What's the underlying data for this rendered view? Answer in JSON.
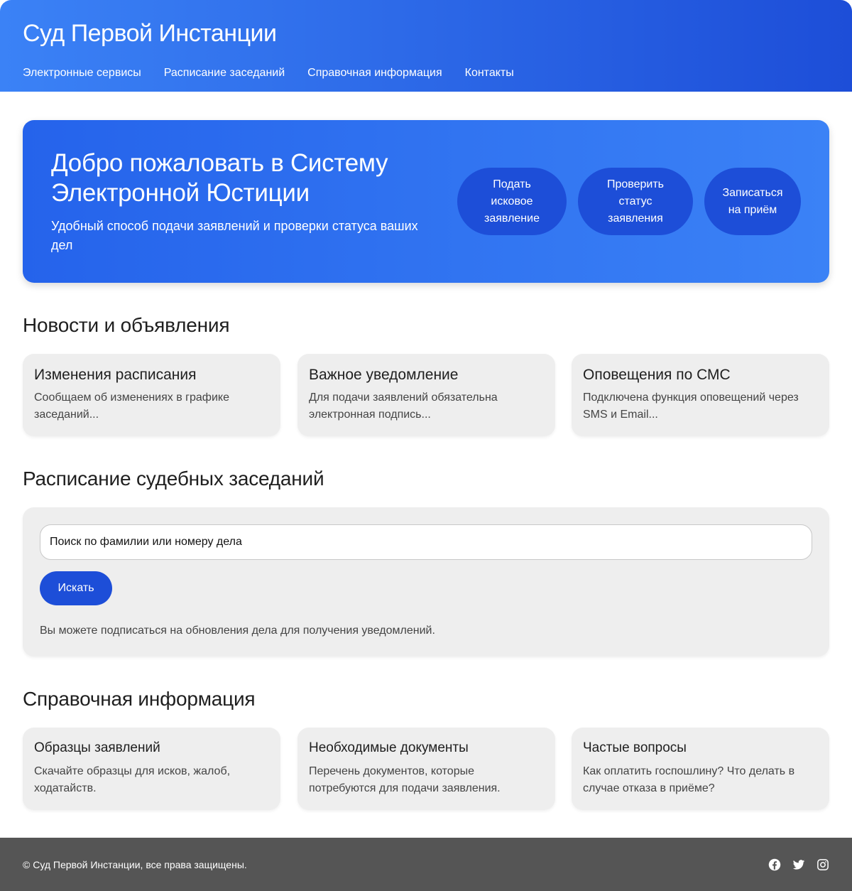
{
  "header": {
    "title": "Суд Первой Инстанции",
    "nav": [
      "Электронные сервисы",
      "Расписание заседаний",
      "Справочная информация",
      "Контакты"
    ]
  },
  "hero": {
    "title": "Добро пожаловать в Систему Электронной Юстиции",
    "subtitle": "Удобный способ подачи заявлений и проверки статуса ваших дел",
    "actions": [
      "Подать исковое заявление",
      "Проверить статус заявления",
      "Записаться на приём"
    ]
  },
  "news": {
    "title": "Новости и объявления",
    "cards": [
      {
        "title": "Изменения расписания",
        "text": "Сообщаем об изменениях в графике заседаний..."
      },
      {
        "title": "Важное уведомление",
        "text": "Для подачи заявлений обязательна электронная подпись..."
      },
      {
        "title": "Оповещения по СМС",
        "text": "Подключена функция оповещений через SMS и Email..."
      }
    ]
  },
  "schedule": {
    "title": "Расписание судебных заседаний",
    "search_placeholder": "Поиск по фамилии или номеру дела",
    "search_button": "Искать",
    "note": "Вы можете подписаться на обновления дела для получения уведомлений."
  },
  "reference": {
    "title": "Справочная информация",
    "cards": [
      {
        "title": "Образцы заявлений",
        "text": "Скачайте образцы для исков, жалоб, ходатайств."
      },
      {
        "title": "Необходимые документы",
        "text": "Перечень документов, которые потребуются для подачи заявления."
      },
      {
        "title": "Частые вопросы",
        "text": "Как оплатить госпошлину? Что делать в случае отказа в приёме?"
      }
    ]
  },
  "footer": {
    "copyright": "© Суд Первой Инстанции, все права защищены.",
    "socials": [
      "facebook-icon",
      "twitter-icon",
      "instagram-icon"
    ]
  },
  "colors": {
    "primary": "#1d4ed8",
    "primary_light": "#3b82f6",
    "card_bg": "#eeeeee",
    "footer_bg": "#555555"
  }
}
